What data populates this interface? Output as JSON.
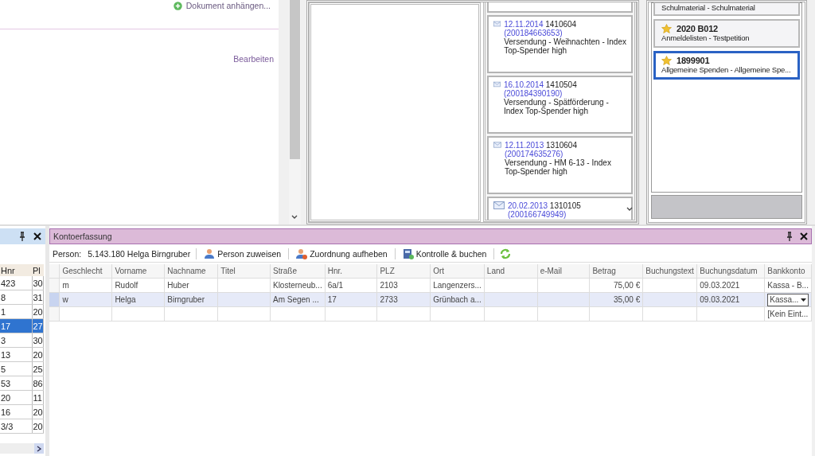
{
  "attachment": {
    "label": "Dokument anhängen..."
  },
  "edit_link": {
    "label": "Bearbeiten"
  },
  "mailings": [
    {
      "kind": "stub"
    },
    {
      "date": "12.11.2014",
      "number": "1410604",
      "code": "(200184663653)",
      "text": "Versendung - Weihnachten - Index Top-Spender high"
    },
    {
      "date": "16.10.2014",
      "number": "1410504",
      "code": "(200184390190)",
      "text": "Versendung - Spätförderung - Index Top-Spender high"
    },
    {
      "date": "12.11.2013",
      "number": "1310604",
      "code": "(200174635276)",
      "text": "Versendung - HM 6-13 - Index Top-Spender high"
    },
    {
      "date": "20.02.2013",
      "number": "1310105",
      "code": "(200166749949)"
    }
  ],
  "projects": [
    {
      "text": "Schulmaterial - Schulmaterial",
      "selected": false
    },
    {
      "title": "2020 B012",
      "text": "Anmeldelisten - Testpetition",
      "selected": false
    },
    {
      "title": "1899901",
      "text": "Allgemeine Spenden - Allgemeine Spe...",
      "selected": true
    }
  ],
  "side_table": {
    "columns": [
      "Hnr",
      "Pl"
    ],
    "rows": [
      {
        "cells": [
          "423",
          "30"
        ],
        "selected": false
      },
      {
        "cells": [
          "8",
          "31"
        ],
        "selected": false
      },
      {
        "cells": [
          "1",
          "20"
        ],
        "selected": false
      },
      {
        "cells": [
          "17",
          "27"
        ],
        "selected": true
      },
      {
        "cells": [
          "3",
          "30"
        ],
        "selected": false
      },
      {
        "cells": [
          "13",
          "20"
        ],
        "selected": false
      },
      {
        "cells": [
          "5",
          "25"
        ],
        "selected": false
      },
      {
        "cells": [
          "53",
          "86"
        ],
        "selected": false
      },
      {
        "cells": [
          "20",
          "11"
        ],
        "selected": false
      },
      {
        "cells": [
          "16",
          "20"
        ],
        "selected": false
      },
      {
        "cells": [
          "3/3",
          "20"
        ],
        "selected": false
      }
    ]
  },
  "panel": {
    "title": "Kontoerfassung",
    "person_label": "Person:",
    "person": "5.143.180 Helga Birngruber",
    "toolbar": [
      {
        "kind": "assign",
        "label": "Person zuweisen"
      },
      {
        "kind": "unassign",
        "label": "Zuordnung aufheben"
      },
      {
        "kind": "book",
        "label": "Kontrolle & buchen"
      },
      {
        "kind": "refresh"
      }
    ]
  },
  "grid": {
    "columns": [
      "Geschlecht",
      "Vorname",
      "Nachname",
      "Titel",
      "Straße",
      "Hnr.",
      "PLZ",
      "Ort",
      "Land",
      "e-Mail",
      "Betrag",
      "Buchungstext",
      "Buchungsdatum",
      "Bankkonto"
    ],
    "rows": [
      {
        "selected": false,
        "dropdown": false,
        "cells": [
          "m",
          "Rudolf",
          "Huber",
          null,
          "Klosterneub...",
          "6a/1",
          "2103",
          "Langenzers...",
          null,
          null,
          "75,00 €",
          null,
          "09.03.2021",
          "Kassa - B..."
        ]
      },
      {
        "selected": true,
        "dropdown": true,
        "cells": [
          "w",
          "Helga",
          "Birngruber",
          null,
          "Am Segen ...",
          "17",
          "2733",
          "Grünbach a...",
          null,
          null,
          "35,00 €",
          null,
          "09.03.2021",
          "Kassa..."
        ]
      },
      {
        "selected": false,
        "dropdown": false,
        "cells": [
          null,
          null,
          null,
          null,
          null,
          null,
          null,
          null,
          null,
          null,
          null,
          null,
          null,
          "[Kein Eint..."
        ]
      }
    ]
  }
}
